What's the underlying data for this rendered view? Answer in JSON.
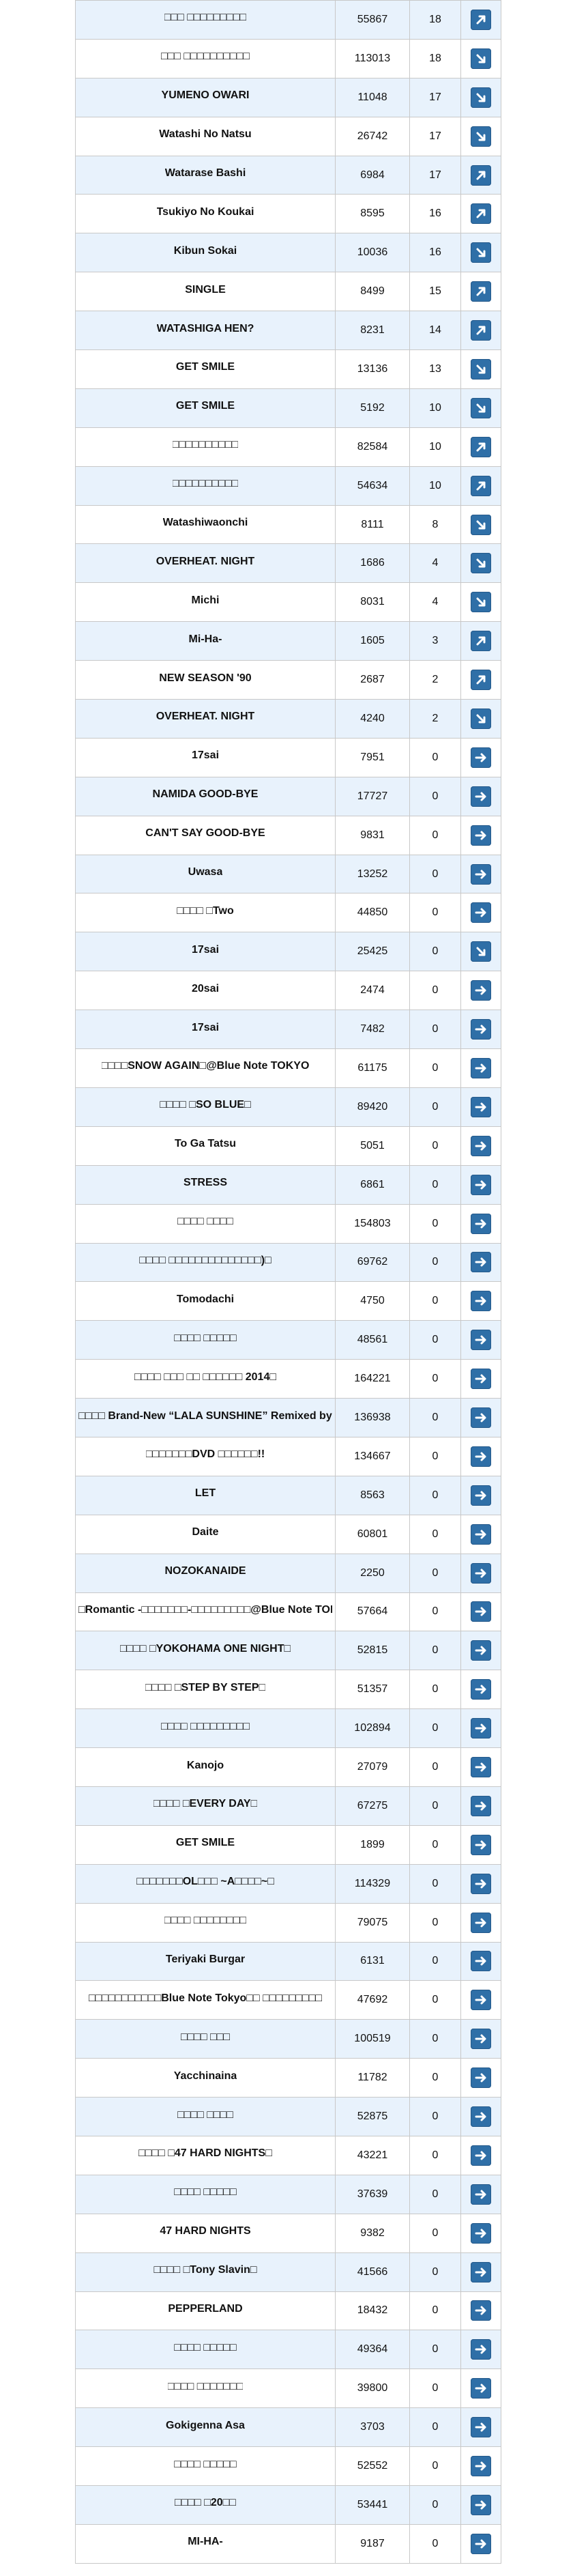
{
  "colors": {
    "row_alt": "#e8f2fc",
    "row": "#ffffff",
    "trend_button": "#2f6fa7",
    "border": "#c8c8c8"
  },
  "rows": [
    {
      "title": "□□□ □□□□□□□□□",
      "count": "55867",
      "score": "18",
      "trend": "up"
    },
    {
      "title": "□□□ □□□□□□□□□□",
      "count": "113013",
      "score": "18",
      "trend": "down"
    },
    {
      "title": "YUMENO OWARI",
      "count": "11048",
      "score": "17",
      "trend": "down"
    },
    {
      "title": "Watashi No Natsu",
      "count": "26742",
      "score": "17",
      "trend": "down"
    },
    {
      "title": "Watarase Bashi",
      "count": "6984",
      "score": "17",
      "trend": "up"
    },
    {
      "title": "Tsukiyo No Koukai",
      "count": "8595",
      "score": "16",
      "trend": "up"
    },
    {
      "title": "Kibun Sokai",
      "count": "10036",
      "score": "16",
      "trend": "down"
    },
    {
      "title": "SINGLE",
      "count": "8499",
      "score": "15",
      "trend": "up"
    },
    {
      "title": "WATASHIGA HEN?",
      "count": "8231",
      "score": "14",
      "trend": "up"
    },
    {
      "title": "GET SMILE",
      "count": "13136",
      "score": "13",
      "trend": "down"
    },
    {
      "title": "GET SMILE",
      "count": "5192",
      "score": "10",
      "trend": "down"
    },
    {
      "title": "□□□□□□□□□□",
      "count": "82584",
      "score": "10",
      "trend": "up"
    },
    {
      "title": "□□□□□□□□□□",
      "count": "54634",
      "score": "10",
      "trend": "up"
    },
    {
      "title": "Watashiwaonchi",
      "count": "8111",
      "score": "8",
      "trend": "down"
    },
    {
      "title": "OVERHEAT. NIGHT",
      "count": "1686",
      "score": "4",
      "trend": "down"
    },
    {
      "title": "Michi",
      "count": "8031",
      "score": "4",
      "trend": "down"
    },
    {
      "title": "Mi-Ha-",
      "count": "1605",
      "score": "3",
      "trend": "up"
    },
    {
      "title": "NEW SEASON '90",
      "count": "2687",
      "score": "2",
      "trend": "up"
    },
    {
      "title": "OVERHEAT. NIGHT",
      "count": "4240",
      "score": "2",
      "trend": "down"
    },
    {
      "title": "17sai",
      "count": "7951",
      "score": "0",
      "trend": "right"
    },
    {
      "title": "NAMIDA GOOD-BYE",
      "count": "17727",
      "score": "0",
      "trend": "right"
    },
    {
      "title": "CAN'T SAY GOOD-BYE",
      "count": "9831",
      "score": "0",
      "trend": "right"
    },
    {
      "title": "Uwasa",
      "count": "13252",
      "score": "0",
      "trend": "right"
    },
    {
      "title": "□□□□ □Two",
      "count": "44850",
      "score": "0",
      "trend": "right"
    },
    {
      "title": "17sai",
      "count": "25425",
      "score": "0",
      "trend": "down"
    },
    {
      "title": "20sai",
      "count": "2474",
      "score": "0",
      "trend": "right"
    },
    {
      "title": "17sai",
      "count": "7482",
      "score": "0",
      "trend": "right"
    },
    {
      "title": "□□□□SNOW AGAIN□@Blue Note TOKYO",
      "count": "61175",
      "score": "0",
      "trend": "right"
    },
    {
      "title": "□□□□ □SO BLUE□",
      "count": "89420",
      "score": "0",
      "trend": "right"
    },
    {
      "title": "To Ga Tatsu",
      "count": "5051",
      "score": "0",
      "trend": "right"
    },
    {
      "title": "STRESS",
      "count": "6861",
      "score": "0",
      "trend": "right"
    },
    {
      "title": "□□□□ □□□□",
      "count": "154803",
      "score": "0",
      "trend": "right"
    },
    {
      "title": "□□□□ □□□□□□□□□□□□□□)□",
      "count": "69762",
      "score": "0",
      "trend": "right"
    },
    {
      "title": "Tomodachi",
      "count": "4750",
      "score": "0",
      "trend": "right"
    },
    {
      "title": "□□□□ □□□□□",
      "count": "48561",
      "score": "0",
      "trend": "right"
    },
    {
      "title": "□□□□ □□□ □□ □□□□□□ 2014□",
      "count": "164221",
      "score": "0",
      "trend": "right"
    },
    {
      "title": "□□□□ Brand-New “LALA SUNSHINE” Remixed by",
      "count": "136938",
      "score": "0",
      "trend": "right"
    },
    {
      "title": "□□□□□□□DVD □□□□□□!!",
      "count": "134667",
      "score": "0",
      "trend": "right"
    },
    {
      "title": "LET",
      "count": "8563",
      "score": "0",
      "trend": "right"
    },
    {
      "title": "Daite",
      "count": "60801",
      "score": "0",
      "trend": "right"
    },
    {
      "title": "NOZOKANAIDE",
      "count": "2250",
      "score": "0",
      "trend": "right"
    },
    {
      "title": "□Romantic -□□□□□□□-□□□□□□□□□@Blue Note TOKYO",
      "count": "57664",
      "score": "0",
      "trend": "right"
    },
    {
      "title": "□□□□ □YOKOHAMA ONE NIGHT□",
      "count": "52815",
      "score": "0",
      "trend": "right"
    },
    {
      "title": "□□□□ □STEP BY STEP□",
      "count": "51357",
      "score": "0",
      "trend": "right"
    },
    {
      "title": "□□□□ □□□□□□□□□",
      "count": "102894",
      "score": "0",
      "trend": "right"
    },
    {
      "title": "Kanojo",
      "count": "27079",
      "score": "0",
      "trend": "right"
    },
    {
      "title": "□□□□ □EVERY DAY□",
      "count": "67275",
      "score": "0",
      "trend": "right"
    },
    {
      "title": "GET SMILE",
      "count": "1899",
      "score": "0",
      "trend": "right"
    },
    {
      "title": "□□□□□□□OL□□□ ~A□□□□~□",
      "count": "114329",
      "score": "0",
      "trend": "right"
    },
    {
      "title": "□□□□ □□□□□□□□",
      "count": "79075",
      "score": "0",
      "trend": "right"
    },
    {
      "title": "Teriyaki Burgar",
      "count": "6131",
      "score": "0",
      "trend": "right"
    },
    {
      "title": "□□□□□□□□□□□Blue Note Tokyo□□ □□□□□□□□□",
      "count": "47692",
      "score": "0",
      "trend": "right"
    },
    {
      "title": "□□□□ □□□",
      "count": "100519",
      "score": "0",
      "trend": "right"
    },
    {
      "title": "Yacchinaina",
      "count": "11782",
      "score": "0",
      "trend": "right"
    },
    {
      "title": "□□□□ □□□□",
      "count": "52875",
      "score": "0",
      "trend": "right"
    },
    {
      "title": "□□□□ □47 HARD NIGHTS□",
      "count": "43221",
      "score": "0",
      "trend": "right"
    },
    {
      "title": "□□□□ □□□□□",
      "count": "37639",
      "score": "0",
      "trend": "right"
    },
    {
      "title": "47 HARD NIGHTS",
      "count": "9382",
      "score": "0",
      "trend": "right"
    },
    {
      "title": "□□□□ □Tony Slavin□",
      "count": "41566",
      "score": "0",
      "trend": "right"
    },
    {
      "title": "PEPPERLAND",
      "count": "18432",
      "score": "0",
      "trend": "right"
    },
    {
      "title": "□□□□ □□□□□",
      "count": "49364",
      "score": "0",
      "trend": "right"
    },
    {
      "title": "□□□□ □□□□□□□",
      "count": "39800",
      "score": "0",
      "trend": "right"
    },
    {
      "title": "Gokigenna Asa",
      "count": "3703",
      "score": "0",
      "trend": "right"
    },
    {
      "title": "□□□□ □□□□□",
      "count": "52552",
      "score": "0",
      "trend": "right"
    },
    {
      "title": "□□□□ □20□□",
      "count": "53441",
      "score": "0",
      "trend": "right"
    },
    {
      "title": "MI-HA-",
      "count": "9187",
      "score": "0",
      "trend": "right"
    }
  ]
}
